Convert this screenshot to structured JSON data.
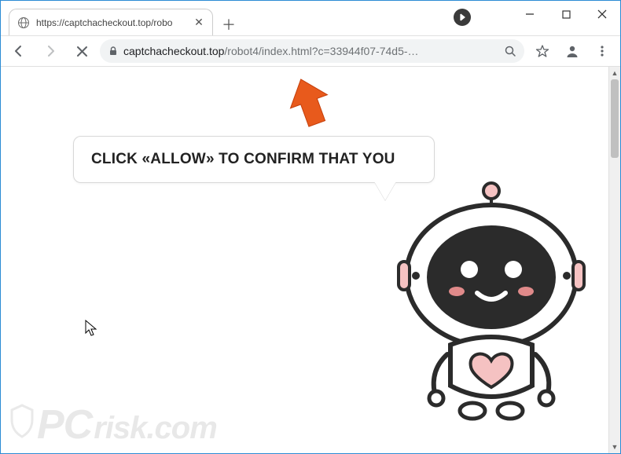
{
  "window": {
    "min": "−",
    "max": "☐",
    "close": "✕"
  },
  "tab": {
    "title": "https://captchacheckout.top/robo",
    "close": "✕",
    "newtab": "＋"
  },
  "toolbar": {
    "back": "←",
    "forward": "→",
    "stop": "✕"
  },
  "address": {
    "host": "captchacheckout.top",
    "path": "/robot4/index.html?c=33944f07-74d5-…"
  },
  "page": {
    "speech": "CLICK «ALLOW» TO CONFIRM THAT YOU"
  },
  "scrollbar": {
    "up": "▲",
    "down": "▼"
  },
  "watermark": {
    "pc": "PC",
    "risk": "risk.com"
  },
  "icons": {
    "favicon": "globe-icon",
    "lock": "lock-icon",
    "search": "search-icon",
    "star": "star-icon",
    "profile": "profile-icon",
    "menu": "menu-icon",
    "media": "media-icon",
    "arrow": "pointer-arrow",
    "cursor": "mouse-cursor"
  }
}
